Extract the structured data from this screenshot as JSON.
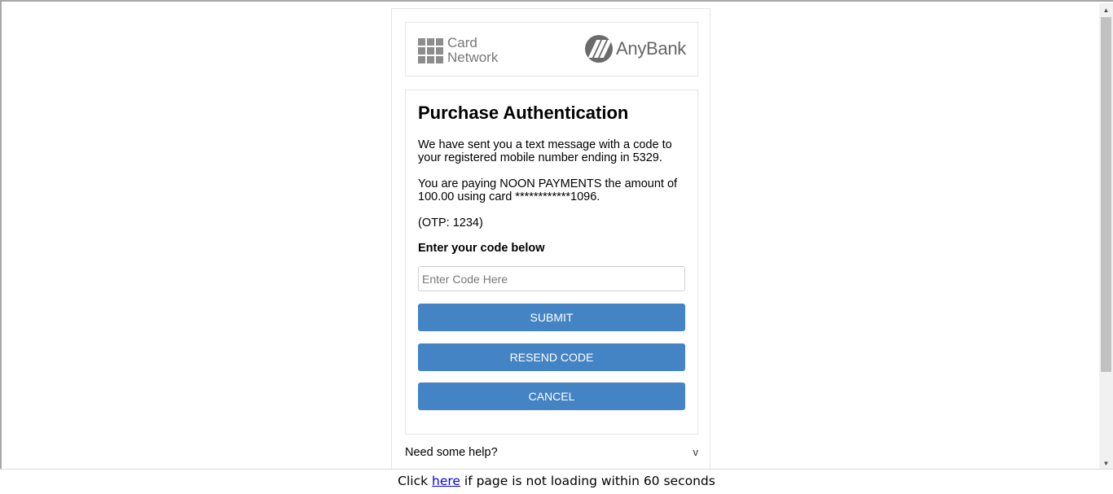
{
  "logos": {
    "card_network_line1": "Card",
    "card_network_line2": "Network",
    "bank_name": "AnyBank"
  },
  "auth": {
    "title": "Purchase Authentication",
    "message_sent": "We have sent you a text message with a code to your registered mobile number ending in 5329.",
    "payment_info": "You are paying NOON PAYMENTS the amount of 100.00 using card ************1096.",
    "otp_hint": "(OTP: 1234)",
    "code_label": "Enter your code below",
    "code_placeholder": "Enter Code Here",
    "code_value": ""
  },
  "buttons": {
    "submit": "SUBMIT",
    "resend": "RESEND CODE",
    "cancel": "CANCEL"
  },
  "help": {
    "label": "Need some help?",
    "toggle": "v"
  },
  "footer": {
    "prefix": "Click",
    "link": "here",
    "suffix": "if page is not loading within 60 seconds"
  },
  "colors": {
    "button": "#4584c4",
    "link": "#0000ee",
    "border": "#e6e6e6"
  }
}
